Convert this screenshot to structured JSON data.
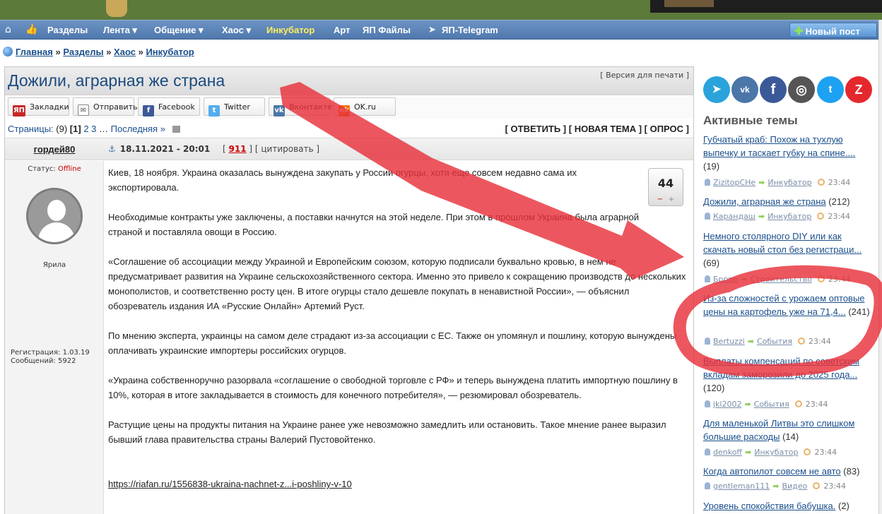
{
  "nav": {
    "items": [
      "Разделы",
      "Лента ▾",
      "Общение ▾",
      "Хаос ▾",
      "Инкубатор",
      "Арт",
      "ЯП Файлы",
      "ЯП-Telegram"
    ],
    "new_post": "Новый пост"
  },
  "breadcrumb": {
    "home": "Главная",
    "sep": "»",
    "sections": "Разделы",
    "chaos": "Хаос",
    "incubator": "Инкубатор"
  },
  "thread": {
    "title": "Дожили, аграрная же страна",
    "print_link": "Версия для печати",
    "share": [
      "Закладки",
      "Отправить",
      "Facebook",
      "Twitter",
      "Вконтакте",
      "OK.ru"
    ],
    "pages_label": "Страницы:",
    "pages_count": "(9)",
    "current_page": "[1]",
    "page2": "2",
    "page3": "3",
    "last_page": "Последняя »",
    "actions": "[ ОТВЕТИТЬ ] [ НОВАЯ ТЕМА ] [ ОПРОС ]"
  },
  "post": {
    "author": "гордей80",
    "date": "18.11.2021 - 20:01",
    "number": "911",
    "quote": "цитировать",
    "status_label": "Статус:",
    "status_value": "Offline",
    "rank": "Ярила",
    "registration": "Регистрация: 1.03.19",
    "messages": "Сообщений: 5922",
    "rating": "44",
    "paragraphs": [
      "Киев, 18 ноября. Украина оказалась вынуждена закупать у России огурцы, хотя еще совсем недавно сама их экспортировала.",
      "Необходимые контракты уже заключены, а поставки начнутся на этой неделе. При этом в прошлом Украина была аграрной страной и поставляла овощи в Россию.",
      "«Соглашение об ассоциации между Украиной и Европейским союзом, которую подписали буквально кровью, в нем не предусматривает развития на Украине сельскохозяйственного сектора. Именно это привело к сокращению производств до нескольких монополистов, и соответственно росту цен. В итоге огурцы стало дешевле покупать в ненавистной России», — объяснил обозреватель издания ИА «Русские Онлайн» Артемий Руст.",
      "По мнению эксперта, украинцы на самом деле страдают из-за ассоциации с ЕС. Также он упомянул и пошлину, которую вынуждены оплачивать украинские импортеры российских огурцов.",
      "«Украина собственноручно разорвала «соглашение о свободной торговле с РФ» и теперь вынуждена платить импортную пошлину в 10%, которая в итоге закладывается в стоимость для конечного потребителя», — резюмировал обозреватель.",
      "Растущие цены на продукты питания на Украине ранее уже невозможно замедлить или остановить. Такое мнение ранее выразил бывший глава правительства страны Валерий Пустовойтенко."
    ],
    "link": "https://riafan.ru/1556838-ukraina-nachnet-z...i-poshliny-v-10"
  },
  "sidebar": {
    "title": "Активные темы",
    "topics": [
      {
        "title": "Губчатый краб: Похож на тухлую выпечку и таскает губку на спине....",
        "count": "(19)",
        "user": "ZizitopCHe",
        "section": "Инкубатор",
        "time": "23:44"
      },
      {
        "title": "Дожили, аграрная же страна",
        "count": "(212)",
        "user": "Карандаш",
        "section": "Инкубатор",
        "time": "23:44"
      },
      {
        "title": "Немного столярного DIY или как скачать новый стол без регистраци...",
        "count": "(69)",
        "user": "Бpppp",
        "section": "Строительство",
        "time": "23:44"
      },
      {
        "title": "Из-за сложностей с урожаем оптовые цены на картофель уже на 71,4...",
        "count": "(241)",
        "user": "Bertuzzi",
        "section": "События",
        "time": "23:44"
      },
      {
        "title": "Выплаты компенсаций по советским вкладам заморозили до 2025 года...",
        "count": "(120)",
        "user": "jkl2002",
        "section": "События",
        "time": "23:44"
      },
      {
        "title": "Для маленькой Литвы это слишком большие расходы",
        "count": "(14)",
        "user": "denkoff",
        "section": "Инкубатор",
        "time": "23:44"
      },
      {
        "title": "Когда автопилот совсем не авто",
        "count": "(83)",
        "user": "gentleman111",
        "section": "Видео",
        "time": "23:44"
      },
      {
        "title": "Уровень спокойствия бабушка.",
        "count": "(2)",
        "user": "",
        "section": "",
        "time": ""
      }
    ]
  },
  "colors": {
    "nav": "#5b82b8",
    "link": "#1a4f8c",
    "highlight": "#ffef5c",
    "annotation": "#e8323c"
  }
}
